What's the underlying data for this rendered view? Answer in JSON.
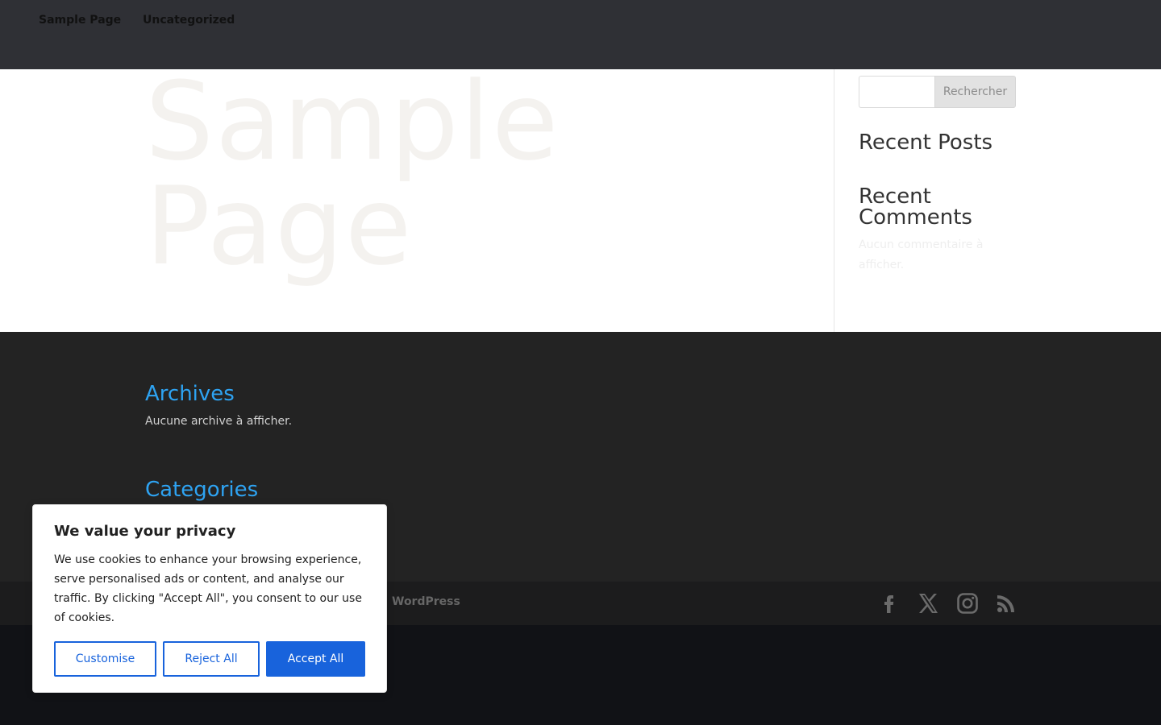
{
  "header": {
    "nav": [
      "Sample Page",
      "Uncategorized"
    ]
  },
  "main": {
    "page_title": "Sample Page"
  },
  "sidebar": {
    "search": {
      "placeholder": "",
      "button_label": "Rechercher"
    },
    "recent_posts_title": "Recent Posts",
    "recent_comments_title": "Recent Comments",
    "no_comments_text": "Aucun commentaire à afficher."
  },
  "footer": {
    "archives_title": "Archives",
    "no_archives_text": "Aucune archive à afficher.",
    "categories_title": "Categories",
    "credit_visible": "WordPress",
    "social": [
      "facebook-icon",
      "x-icon",
      "instagram-icon",
      "rss-icon"
    ]
  },
  "cookie_banner": {
    "title": "We value your privacy",
    "text": "We use cookies to enhance your browsing experience, serve personalised ads or content, and analyse our traffic. By clicking \"Accept All\", you consent to our use of cookies.",
    "customise_label": "Customise",
    "reject_label": "Reject All",
    "accept_label": "Accept All"
  },
  "colors": {
    "header_bg": "#2f3035",
    "accent_blue": "#2ea3f2",
    "cookie_button_blue": "#1863dc",
    "footer_bg": "#232323"
  }
}
